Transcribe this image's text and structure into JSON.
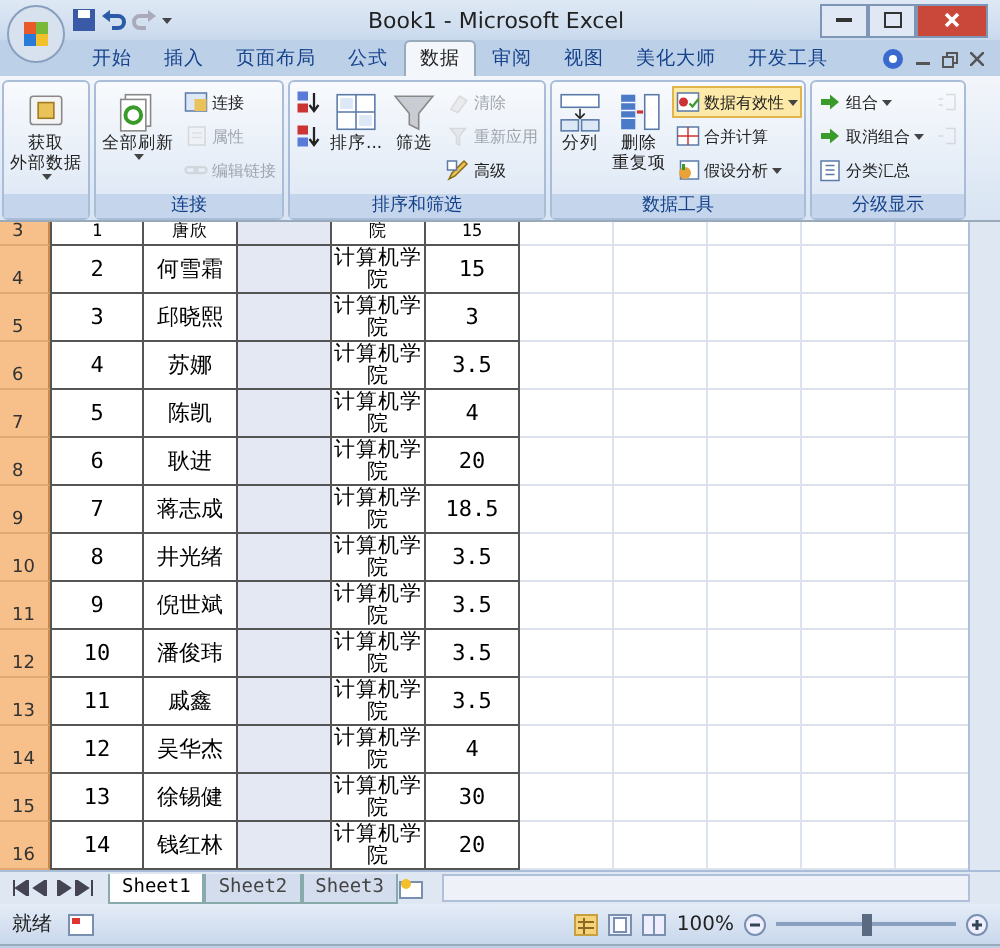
{
  "window": {
    "title": "Book1 - Microsoft Excel"
  },
  "tabs": [
    {
      "label": "开始",
      "selected": false
    },
    {
      "label": "插入",
      "selected": false
    },
    {
      "label": "页面布局",
      "selected": false
    },
    {
      "label": "公式",
      "selected": false
    },
    {
      "label": "数据",
      "selected": true
    },
    {
      "label": "审阅",
      "selected": false
    },
    {
      "label": "视图",
      "selected": false
    },
    {
      "label": "美化大师",
      "selected": false
    },
    {
      "label": "开发工具",
      "selected": false
    }
  ],
  "ribbon": {
    "groups": [
      {
        "buttons": [
          {
            "kind": "big",
            "lines": [
              "获取",
              "外部数据"
            ],
            "disabled": false,
            "dropdown": true,
            "highlighted": false
          }
        ]
      },
      {
        "label": "连接",
        "buttons": [
          {
            "kind": "big",
            "lines": [
              "全部刷新"
            ],
            "disabled": false,
            "dropdown": true,
            "highlighted": false
          },
          {
            "kind": "small",
            "label": "连接",
            "disabled": false,
            "dropdown": false,
            "highlighted": false
          },
          {
            "kind": "small",
            "label": "属性",
            "disabled": true,
            "dropdown": false,
            "highlighted": false
          },
          {
            "kind": "small",
            "label": "编辑链接",
            "disabled": true,
            "dropdown": false,
            "highlighted": false
          }
        ]
      },
      {
        "label": "排序和筛选",
        "buttons": [
          {
            "kind": "icon",
            "disabled": false,
            "dropdown": false,
            "highlighted": false
          },
          {
            "kind": "icon",
            "disabled": false,
            "dropdown": false,
            "highlighted": false
          },
          {
            "kind": "big",
            "lines": [
              "排序..."
            ],
            "disabled": false,
            "dropdown": false,
            "highlighted": false
          },
          {
            "kind": "big",
            "lines": [
              "筛选"
            ],
            "disabled": false,
            "dropdown": false,
            "highlighted": false
          },
          {
            "kind": "small",
            "label": "清除",
            "disabled": true,
            "dropdown": false,
            "highlighted": false
          },
          {
            "kind": "small",
            "label": "重新应用",
            "disabled": true,
            "dropdown": false,
            "highlighted": false
          },
          {
            "kind": "small",
            "label": "高级",
            "disabled": false,
            "dropdown": false,
            "highlighted": false
          }
        ]
      },
      {
        "label": "数据工具",
        "buttons": [
          {
            "kind": "big",
            "lines": [
              "分列"
            ],
            "disabled": false,
            "dropdown": false,
            "highlighted": false
          },
          {
            "kind": "big",
            "lines": [
              "删除",
              "重复项"
            ],
            "disabled": false,
            "dropdown": false,
            "highlighted": false
          },
          {
            "kind": "small",
            "label": "数据有效性",
            "disabled": false,
            "dropdown": true,
            "highlighted": true
          },
          {
            "kind": "small",
            "label": "合并计算",
            "disabled": false,
            "dropdown": false,
            "highlighted": false
          },
          {
            "kind": "small",
            "label": "假设分析",
            "disabled": false,
            "dropdown": true,
            "highlighted": false
          }
        ]
      },
      {
        "label": "分级显示",
        "buttons": [
          {
            "kind": "small",
            "label": "组合",
            "disabled": false,
            "dropdown": true,
            "highlighted": false
          },
          {
            "kind": "small",
            "label": "取消组合",
            "disabled": false,
            "dropdown": true,
            "highlighted": false
          },
          {
            "kind": "small",
            "label": "分类汇总",
            "disabled": false,
            "dropdown": false,
            "highlighted": false
          },
          {
            "kind": "icon",
            "disabled": true,
            "dropdown": false,
            "highlighted": false
          },
          {
            "kind": "icon",
            "disabled": true,
            "dropdown": false,
            "highlighted": false
          }
        ]
      }
    ]
  },
  "sheet": {
    "rows": [
      {
        "header": "3",
        "number": "1",
        "name": "唐欣",
        "college": "院",
        "value": "15"
      },
      {
        "header": "4",
        "number": "2",
        "name": "何雪霜",
        "college": "计算机学院",
        "value": "15"
      },
      {
        "header": "5",
        "number": "3",
        "name": "邱晓熙",
        "college": "计算机学院",
        "value": "3"
      },
      {
        "header": "6",
        "number": "4",
        "name": "苏娜",
        "college": "计算机学院",
        "value": "3.5"
      },
      {
        "header": "7",
        "number": "5",
        "name": "陈凯",
        "college": "计算机学院",
        "value": "4"
      },
      {
        "header": "8",
        "number": "6",
        "name": "耿进",
        "college": "计算机学院",
        "value": "20"
      },
      {
        "header": "9",
        "number": "7",
        "name": "蒋志成",
        "college": "计算机学院",
        "value": "18.5"
      },
      {
        "header": "10",
        "number": "8",
        "name": "井光绪",
        "college": "计算机学院",
        "value": "3.5"
      },
      {
        "header": "11",
        "number": "9",
        "name": "倪世斌",
        "college": "计算机学院",
        "value": "3.5"
      },
      {
        "header": "12",
        "number": "10",
        "name": "潘俊玮",
        "college": "计算机学院",
        "value": "3.5"
      },
      {
        "header": "13",
        "number": "11",
        "name": "戚鑫",
        "college": "计算机学院",
        "value": "3.5"
      },
      {
        "header": "14",
        "number": "12",
        "name": "吴华杰",
        "college": "计算机学院",
        "value": "4"
      },
      {
        "header": "15",
        "number": "13",
        "name": "徐锡健",
        "college": "计算机学院",
        "value": "30"
      },
      {
        "header": "16",
        "number": "14",
        "name": "钱红林",
        "college": "计算机学院",
        "value": "20"
      }
    ]
  },
  "sheet_tabs": [
    {
      "label": "Sheet1",
      "selected": true
    },
    {
      "label": "Sheet2",
      "selected": false
    },
    {
      "label": "Sheet3",
      "selected": false
    }
  ],
  "status_bar": {
    "status": "就绪",
    "zoom": {
      "reading": "100%",
      "level": 0.5
    }
  }
}
